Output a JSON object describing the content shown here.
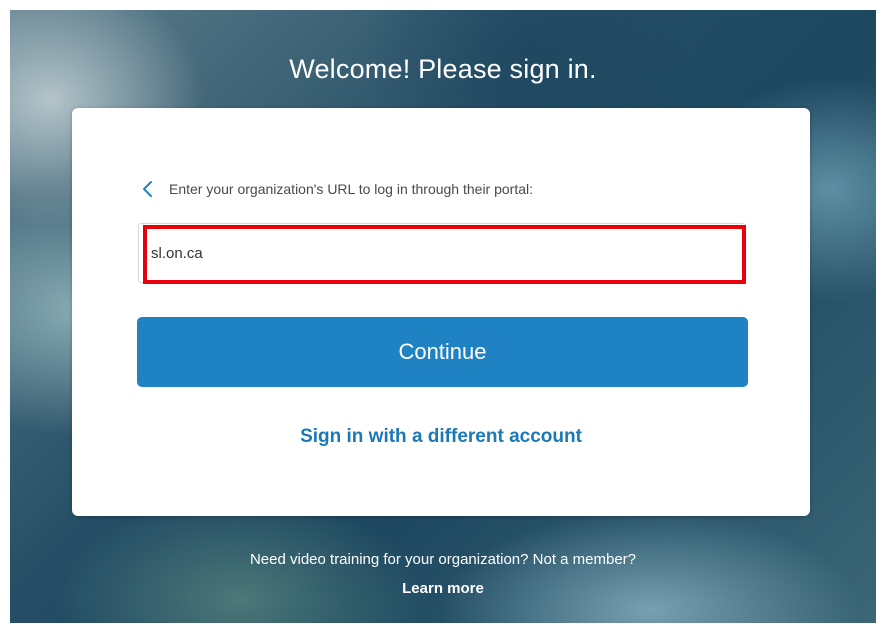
{
  "header": {
    "title": "Welcome! Please sign in."
  },
  "card": {
    "prompt": "Enter your organization's URL to log in through their portal:",
    "back_icon": "chevron-left-icon",
    "url_field": {
      "value": "sl.on.ca",
      "placeholder": ""
    },
    "continue_label": "Continue",
    "alt_signin_label": "Sign in with a different account"
  },
  "footer": {
    "text": "Need video training for your organization? Not a member?",
    "learn_more_label": "Learn more"
  },
  "colors": {
    "accent": "#1f82c2",
    "link": "#1b79b8",
    "highlight": "#e8000b"
  }
}
